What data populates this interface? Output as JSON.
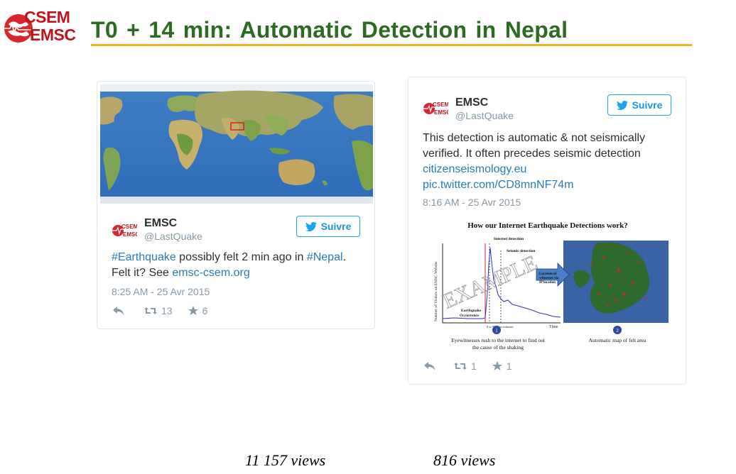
{
  "logo": {
    "line1": "CSEM",
    "line2": "EMSC"
  },
  "page": {
    "title": "T0 + 14 min: Automatic Detection in Nepal"
  },
  "tweet1": {
    "author": "EMSC",
    "handle": "@LastQuake",
    "follow_label": "Suivre",
    "hashtag1": "#Earthquake",
    "text1": " possibly felt 2 min ago in ",
    "hashtag2": "#Nepal",
    "text2": ".",
    "text3": "Felt it? See ",
    "link": "emsc-csem.org",
    "time": "8:25 AM - 25 Avr 2015",
    "retweets": "13",
    "likes": "6"
  },
  "tweet2": {
    "author": "EMSC",
    "handle": "@LastQuake",
    "follow_label": "Suivre",
    "line1": "This detection is automatic & not seismically",
    "line2": "verified. It often precedes seismic detection",
    "link1": "citizenseismology.eu",
    "link2": "pic.twitter.com/CD8mnNF74m",
    "time": "8:16 AM - 25 Avr 2015",
    "retweets": "1",
    "likes": "1"
  },
  "infographic": {
    "title": "How our Internet Earthquake Detections work?",
    "ylabel": "Number of Visitors on EMSC Website",
    "xlabel": "Time",
    "internet_label": "Internet detection",
    "seismic_label": "Seismic detection",
    "earthquake_label": "Earthquake",
    "occurrence_label": "Occurrence",
    "time_marks": "0 to 90s    few minutes",
    "watermark": "EXAMPLE",
    "arrow_line1": "Location of",
    "arrow_line2": "witnesses via",
    "arrow_line3": "IP location",
    "step1": "1",
    "step2": "2",
    "caption1_line1": "Eyewitnesses rush to the internet to find out",
    "caption1_line2": "the cause of the shaking",
    "caption2": "Automatic map of felt area"
  },
  "views": {
    "left": "11 157 views",
    "right": "816 views"
  },
  "colors": {
    "title_green": "#2d6b22",
    "rule_gold": "#f0b325",
    "twitter_blue": "#1da1f2",
    "logo_red": "#c0141b"
  }
}
